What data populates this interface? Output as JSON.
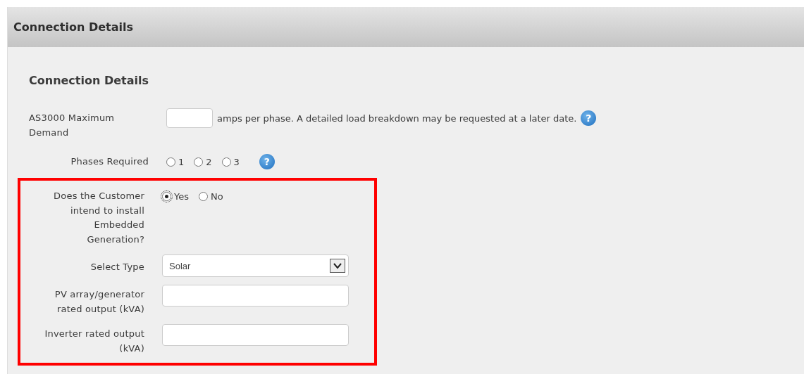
{
  "panel": {
    "title": "Connection Details"
  },
  "section": {
    "heading": "Connection Details"
  },
  "rows": [
    {
      "kind": "text_with_note",
      "label": "AS3000 Maximum Demand",
      "value": "",
      "note": "amps per phase. A detailed load breakdown may be requested at a later date.",
      "help": "?",
      "highlighted": false
    },
    {
      "kind": "radio",
      "label": "Phases Required",
      "options": [
        {
          "label": "1",
          "selected": false
        },
        {
          "label": "2",
          "selected": false
        },
        {
          "label": "3",
          "selected": false
        }
      ],
      "help": "?",
      "highlighted": false
    },
    {
      "kind": "radio",
      "label": "Does the Customer intend to install Embedded Generation?",
      "options": [
        {
          "label": "Yes",
          "selected": true
        },
        {
          "label": "No",
          "selected": false
        }
      ],
      "highlighted": true
    },
    {
      "kind": "select",
      "label": "Select Type",
      "value": "Solar",
      "highlighted": true
    },
    {
      "kind": "text",
      "label": "PV array/generator rated output (kVA)",
      "value": "",
      "highlighted": true
    },
    {
      "kind": "text",
      "label": "Inverter rated output (kVA)",
      "value": "",
      "highlighted": true
    }
  ]
}
